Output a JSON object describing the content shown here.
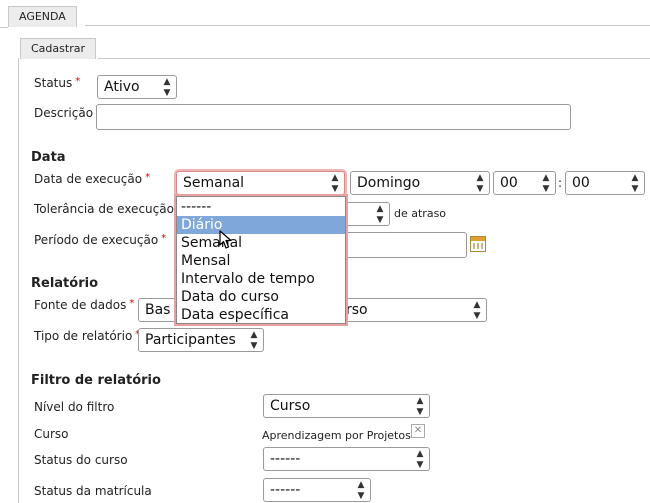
{
  "tabs": {
    "agenda": "AGENDA",
    "cadastrar": "Cadastrar"
  },
  "required_mark": "*",
  "form": {
    "status": {
      "label": "Status",
      "value": "Ativo"
    },
    "descricao": {
      "label": "Descrição",
      "value": ""
    }
  },
  "data_section": {
    "title": "Data",
    "data_execucao": {
      "label": "Data de execução",
      "frequency": "Semanal",
      "weekday": "Domingo",
      "hour": "00",
      "minute": "00",
      "time_sep": ":"
    },
    "tolerancia": {
      "label": "Tolerância de execução",
      "suffix": "de atraso"
    },
    "periodo": {
      "label": "Período de execução"
    }
  },
  "dropdown": {
    "options": [
      "------",
      "Diário",
      "Semanal",
      "Mensal",
      "Intervalo de tempo",
      "Data do curso",
      "Data específica"
    ],
    "highlighted": "Diário"
  },
  "relatorio_section": {
    "title": "Relatório",
    "fonte": {
      "label": "Fonte de dados",
      "value_left": "Bas",
      "value_right": "rso"
    },
    "tipo": {
      "label": "Tipo de relatório",
      "value": "Participantes"
    }
  },
  "filtro_section": {
    "title": "Filtro de relatório",
    "nivel": {
      "label": "Nível do filtro",
      "value": "Curso"
    },
    "curso": {
      "label": "Curso",
      "value": "Aprendizagem por Projetos"
    },
    "status_curso": {
      "label": "Status do curso",
      "value": "------"
    },
    "status_matricula": {
      "label": "Status da matrícula",
      "value": "------"
    }
  },
  "colors": {
    "highlight": "#7fa7d9",
    "focus_border": "#e9a0a0",
    "required": "#dd0000"
  },
  "icons": [
    "select-arrows-icon",
    "calendar-icon",
    "clear-x-icon",
    "mouse-cursor-icon"
  ]
}
